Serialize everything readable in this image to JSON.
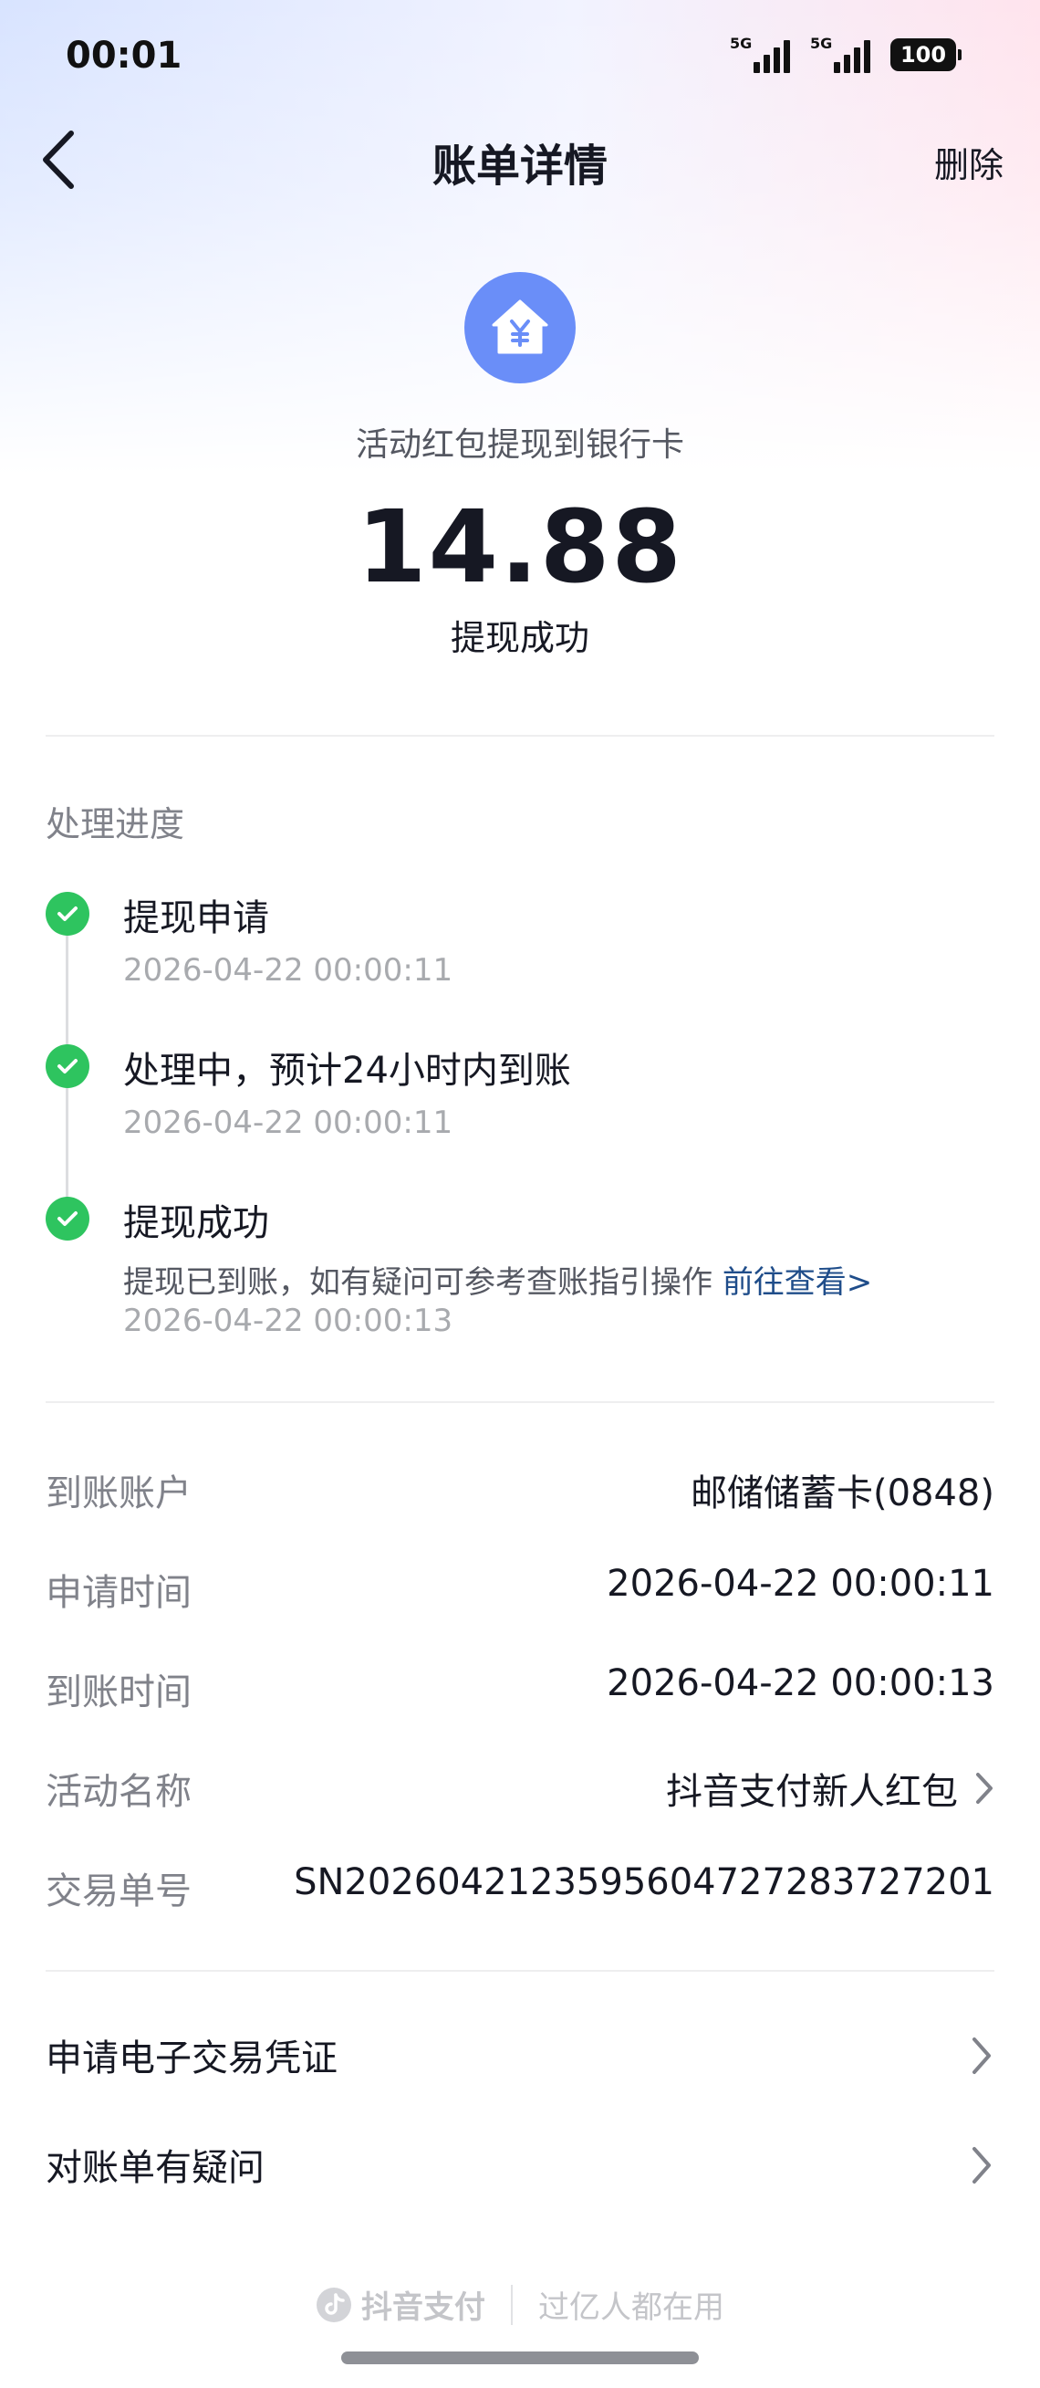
{
  "status_bar": {
    "time": "00:01",
    "signal_1": "5G",
    "signal_2": "5G",
    "battery": "100"
  },
  "nav": {
    "title": "账单详情",
    "delete_label": "删除"
  },
  "hero": {
    "subtitle": "活动红包提现到银行卡",
    "amount": "14.88",
    "status": "提现成功",
    "icon": "yuan-house-icon"
  },
  "progress": {
    "title": "处理进度",
    "steps": [
      {
        "title": "提现申请",
        "time": "2026-04-22 00:00:11"
      },
      {
        "title": "处理中，预计24小时内到账",
        "time": "2026-04-22 00:00:11"
      },
      {
        "title": "提现成功",
        "desc": "提现已到账，如有疑问可参考查账指引操作",
        "link": "前往查看>",
        "time": "2026-04-22 00:00:13"
      }
    ]
  },
  "details": [
    {
      "label": "到账账户",
      "value": "邮储储蓄卡(0848)"
    },
    {
      "label": "申请时间",
      "value": "2026-04-22 00:00:11"
    },
    {
      "label": "到账时间",
      "value": "2026-04-22 00:00:13"
    },
    {
      "label": "活动名称",
      "value": "抖音支付新人红包"
    },
    {
      "label": "交易单号",
      "value": "SN2026042123595604727283727201"
    }
  ],
  "menu": [
    {
      "label": "申请电子交易凭证"
    },
    {
      "label": "对账单有疑问"
    }
  ],
  "footer": {
    "brand": "抖音支付",
    "slogan": "过亿人都在用"
  },
  "colors": {
    "accent_blue": "#6a8ef8",
    "success_green": "#2ec45f",
    "link": "#1f4d8a"
  }
}
